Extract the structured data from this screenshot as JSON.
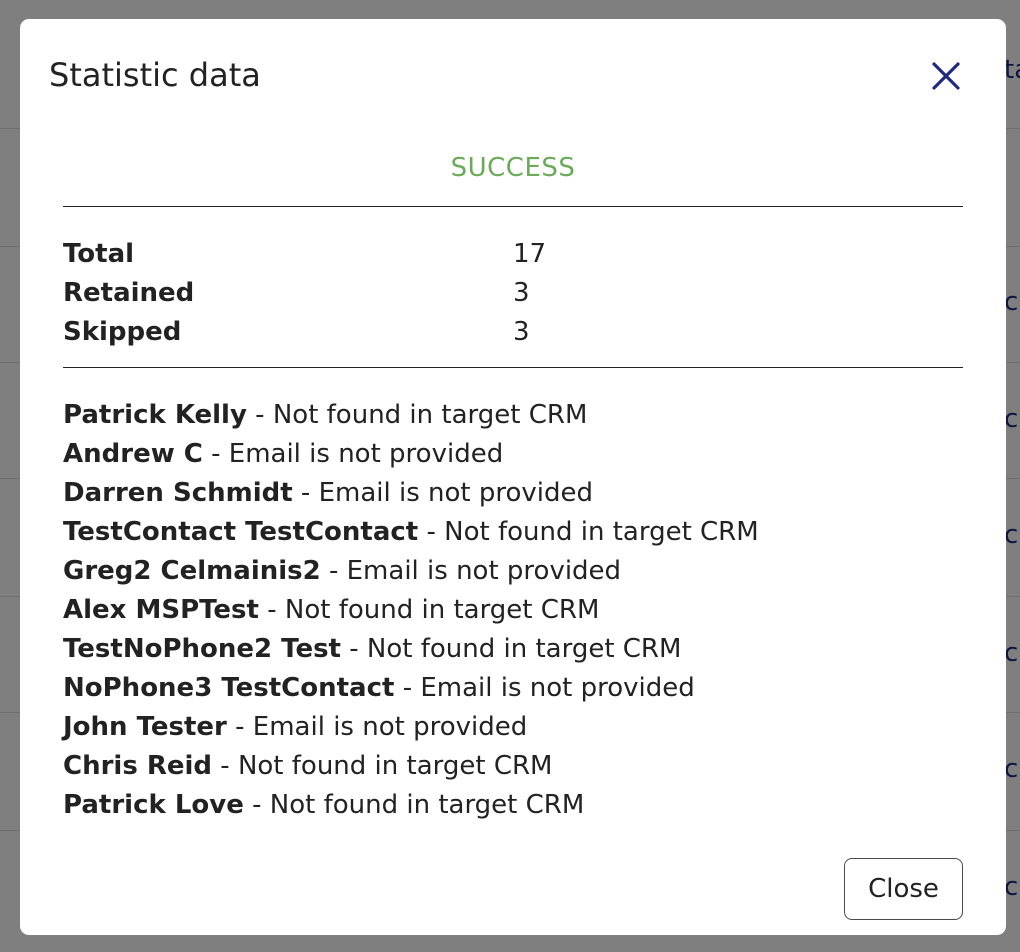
{
  "background": {
    "link_fragments": [
      "ta",
      "ch",
      "ch",
      "ch",
      "ch",
      "ch",
      "ch",
      "ch"
    ]
  },
  "modal": {
    "title": "Statistic data",
    "close_icon": "close-x-icon",
    "status": "SUCCESS",
    "status_color": "#6aaa58",
    "accent_color": "#1f2a80",
    "stats": [
      {
        "label": "Total",
        "value": "17"
      },
      {
        "label": "Retained",
        "value": "3"
      },
      {
        "label": "Skipped",
        "value": "3"
      }
    ],
    "details": [
      {
        "name": "Patrick Kelly",
        "reason": " - Not found in target CRM"
      },
      {
        "name": "Andrew C",
        "reason": " - Email is not provided"
      },
      {
        "name": "Darren Schmidt",
        "reason": " - Email is not provided"
      },
      {
        "name": "TestContact TestContact",
        "reason": " - Not found in target CRM"
      },
      {
        "name": "Greg2 Celmainis2",
        "reason": " - Email is not provided"
      },
      {
        "name": "Alex MSPTest",
        "reason": " - Not found in target CRM"
      },
      {
        "name": "TestNoPhone2 Test",
        "reason": " - Not found in target CRM"
      },
      {
        "name": "NoPhone3 TestContact",
        "reason": " - Email is not provided"
      },
      {
        "name": "John Tester",
        "reason": " - Email is not provided"
      },
      {
        "name": "Chris Reid",
        "reason": " - Not found in target CRM"
      },
      {
        "name": "Patrick Love",
        "reason": " - Not found in target CRM"
      }
    ],
    "close_button_label": "Close"
  }
}
